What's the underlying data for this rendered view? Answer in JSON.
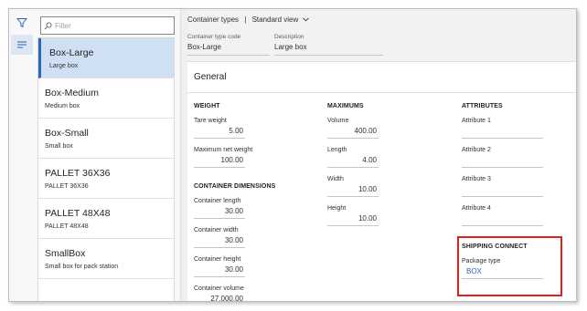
{
  "filter": {
    "placeholder": "Filter"
  },
  "list_items": [
    {
      "title": "Box-Large",
      "subtitle": "Large box"
    },
    {
      "title": "Box-Medium",
      "subtitle": "Medium box"
    },
    {
      "title": "Box-Small",
      "subtitle": "Small box"
    },
    {
      "title": "PALLET 36X36",
      "subtitle": "PALLET 36X36"
    },
    {
      "title": "PALLET 48X48",
      "subtitle": "PALLET 48X48"
    },
    {
      "title": "SmallBox",
      "subtitle": "Small box for pack station"
    }
  ],
  "header": {
    "crumb_page": "Container types",
    "crumb_sep": "|",
    "crumb_view": "Standard view",
    "code_label": "Container type code",
    "code_value": "Box-Large",
    "desc_label": "Description",
    "desc_value": "Large box"
  },
  "general": {
    "title": "General",
    "weight": {
      "heading": "WEIGHT",
      "tare_label": "Tare weight",
      "tare_value": "5.00",
      "maxnet_label": "Maximum net weight",
      "maxnet_value": "100.00"
    },
    "dimensions": {
      "heading": "CONTAINER DIMENSIONS",
      "length_label": "Container length",
      "length_value": "30.00",
      "width_label": "Container width",
      "width_value": "30.00",
      "height_label": "Container height",
      "height_value": "30.00",
      "volume_label": "Container volume",
      "volume_value": "27,000.00"
    },
    "maximums": {
      "heading": "MAXIMUMS",
      "volume_label": "Volume",
      "volume_value": "400.00",
      "length_label": "Length",
      "length_value": "4.00",
      "width_label": "Width",
      "width_value": "10.00",
      "height_label": "Height",
      "height_value": "10.00"
    },
    "attributes": {
      "heading": "ATTRIBUTES",
      "a1_label": "Attribute 1",
      "a1_value": "",
      "a2_label": "Attribute 2",
      "a2_value": "",
      "a3_label": "Attribute 3",
      "a3_value": "",
      "a4_label": "Attribute 4",
      "a4_value": ""
    },
    "shipping": {
      "heading": "SHIPPING CONNECT",
      "package_label": "Package type",
      "package_value": "BOX"
    }
  },
  "colors": {
    "accent": "#2b67b8",
    "selected_bg": "#cfe0f5",
    "highlight": "#e0221c"
  }
}
